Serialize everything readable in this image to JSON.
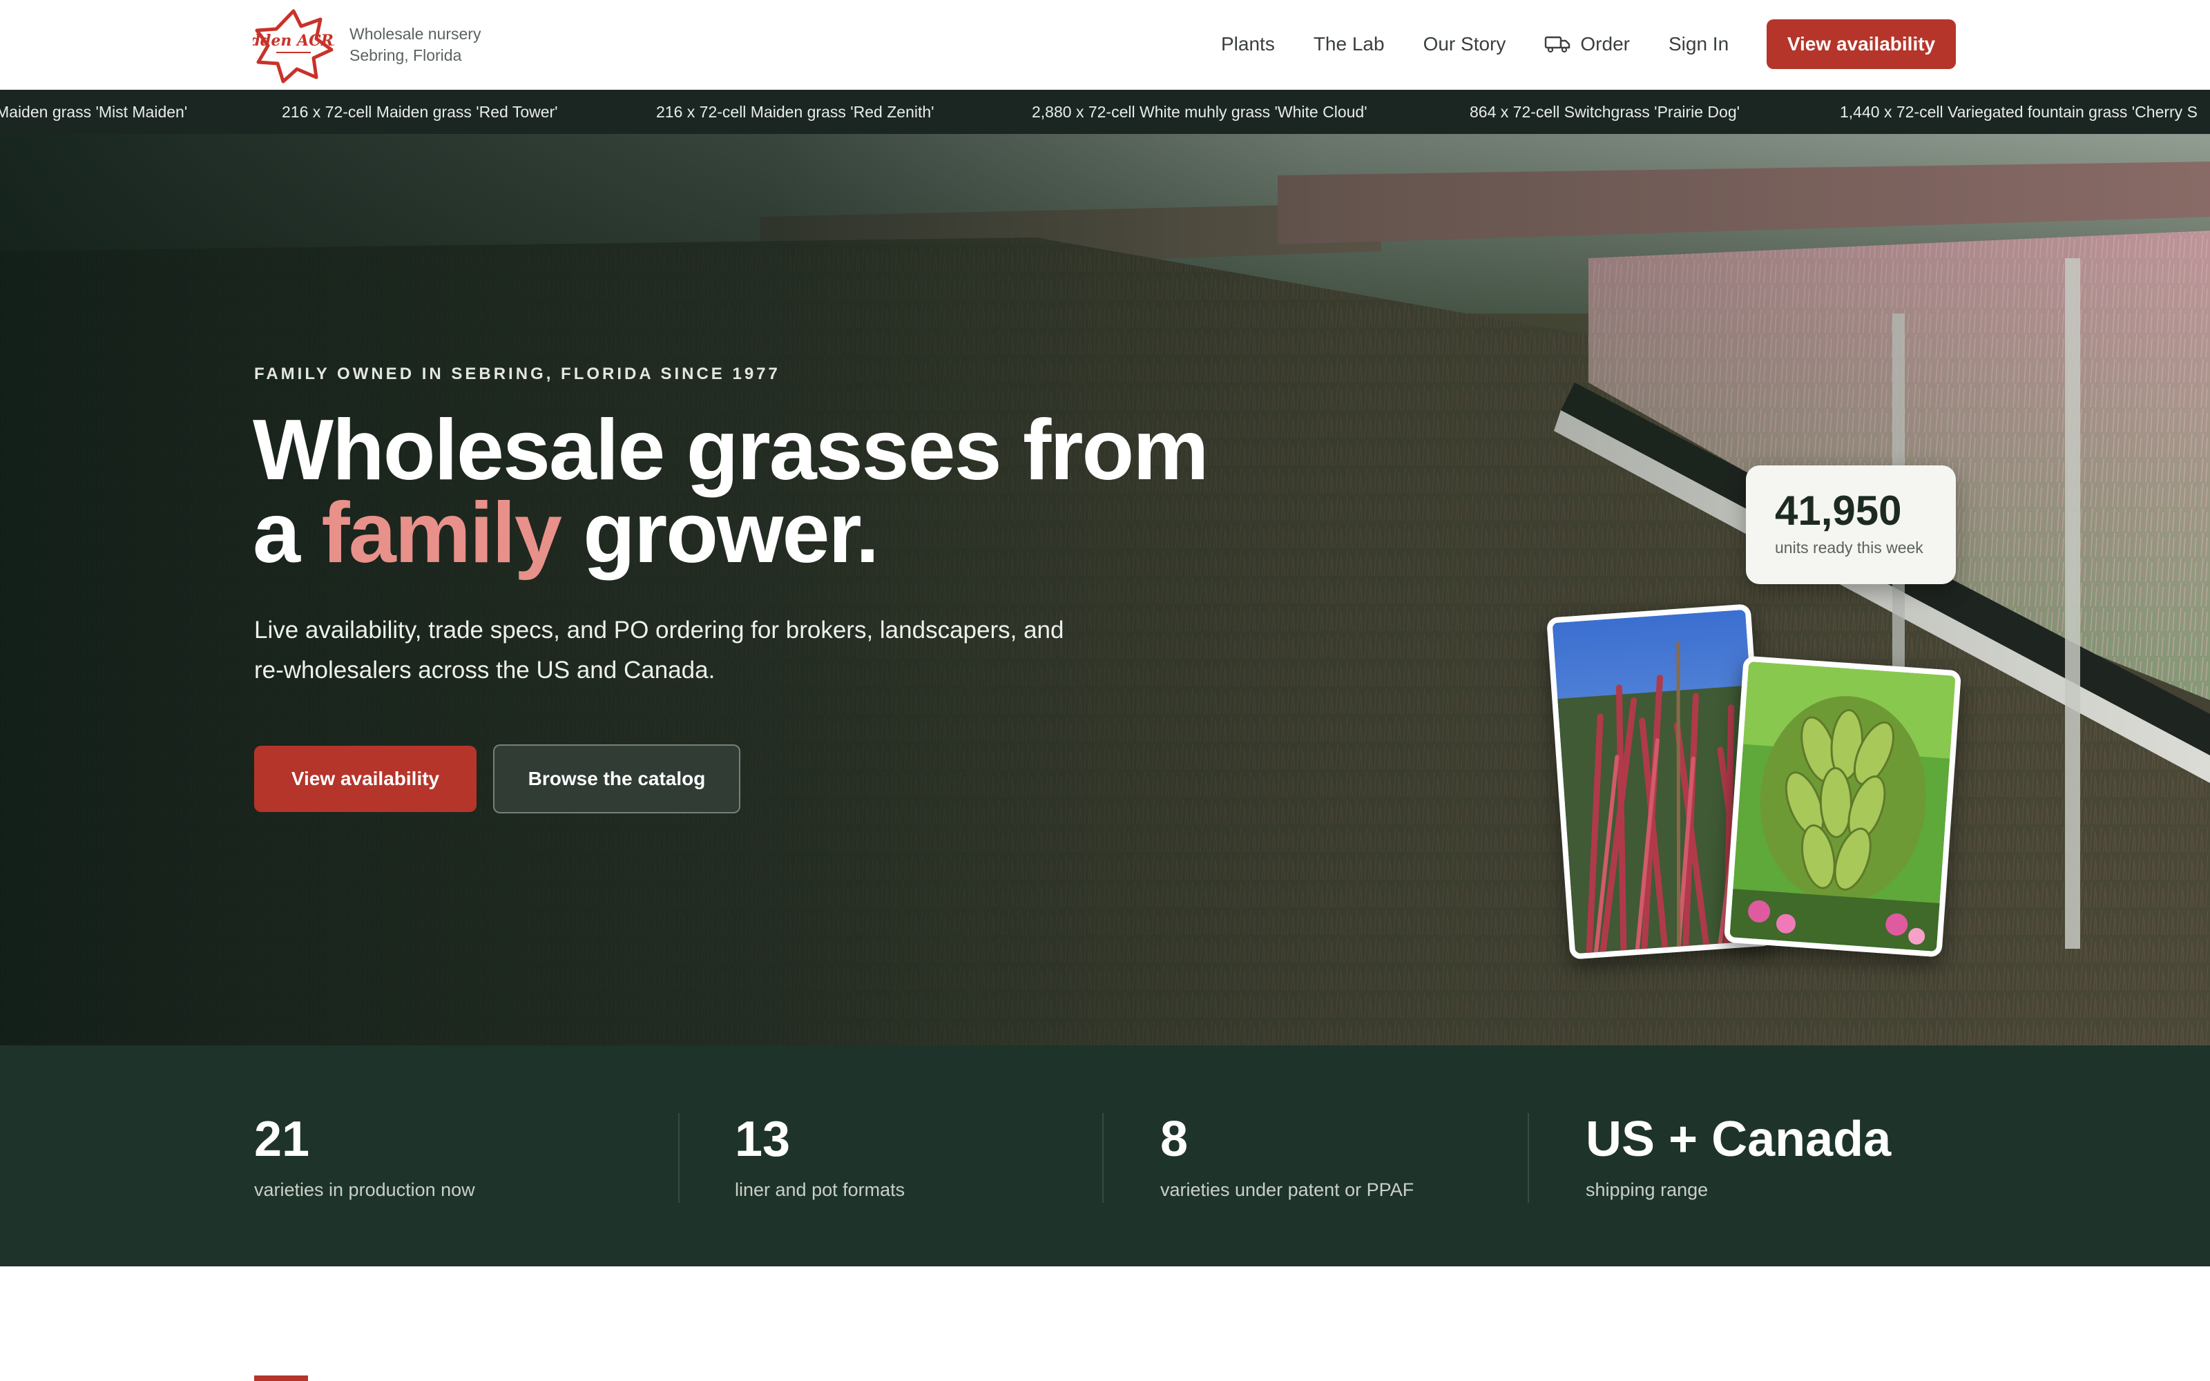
{
  "brand": {
    "logo_text": "Hidden ACRES",
    "tagline_line1": "Wholesale nursery",
    "tagline_line2": "Sebring, Florida"
  },
  "nav": {
    "items": [
      "Plants",
      "The Lab",
      "Our Story",
      "Order",
      "Sign In"
    ],
    "cta": "View availability"
  },
  "ticker": {
    "items": [
      "Maiden grass 'Mist Maiden'",
      "216 x 72-cell Maiden grass 'Red Tower'",
      "216 x 72-cell Maiden grass 'Red Zenith'",
      "2,880 x 72-cell White muhly grass 'White Cloud'",
      "864 x 72-cell Switchgrass 'Prairie Dog'",
      "1,440 x 72-cell Variegated fountain grass 'Cherry S"
    ]
  },
  "hero": {
    "eyebrow": "FAMILY OWNED IN SEBRING, FLORIDA SINCE 1977",
    "headline_line1": "Wholesale grasses from",
    "headline_a": "a",
    "headline_accent": "family",
    "headline_end": "grower.",
    "subline": "Live availability, trade specs, and PO ordering for brokers, landscapers, and re-wholesalers across the US and Canada.",
    "primary_button": "View availability",
    "secondary_button": "Browse the catalog",
    "stock_count": "41,950",
    "stock_label": "units ready this week"
  },
  "stats": [
    {
      "value": "21",
      "label": "varieties in production now"
    },
    {
      "value": "13",
      "label": "liner and pot formats"
    },
    {
      "value": "8",
      "label": "varieties under patent or PPAF"
    },
    {
      "value": "US + Canada",
      "label": "shipping range"
    }
  ],
  "colors": {
    "accent": "#b5352b",
    "accent_text": "#e8918a",
    "ticker_bg": "#1b2622",
    "stats_bg": "#1e3329"
  }
}
